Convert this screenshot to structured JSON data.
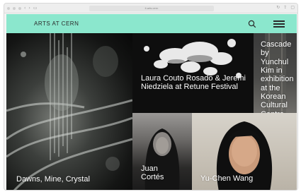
{
  "browser": {
    "url": "it.arts.cern"
  },
  "site": {
    "logo": "ARTS  AT  CERN"
  },
  "tiles": [
    {
      "label": "Dawns, Mine, Crystal"
    },
    {
      "label": "Laura Couto Rosado & Jeremi Niedziela at Retune Festival"
    },
    {
      "label": "Cascade by Yunchul Kim in exhibition at the Korean Cultural Centre UK"
    },
    {
      "label": "Juan Cortés"
    },
    {
      "label": "Yu-Chen Wang"
    }
  ],
  "icons": [
    "search-icon",
    "menu-icon"
  ]
}
